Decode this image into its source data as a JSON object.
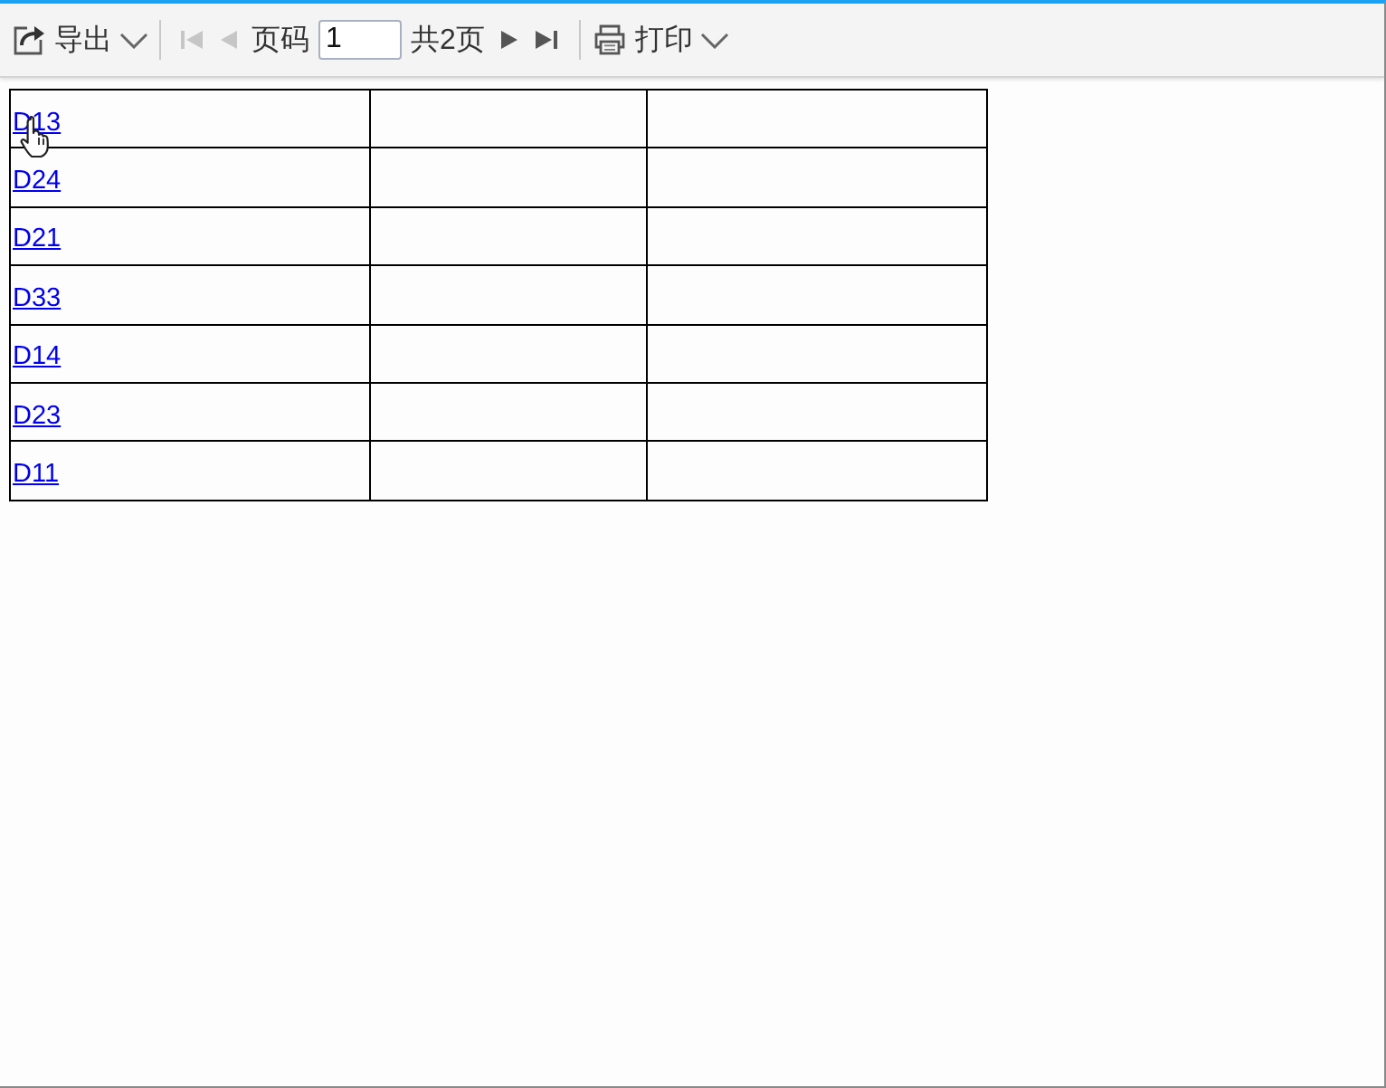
{
  "toolbar": {
    "export": {
      "label": "导出"
    },
    "nav_back": [
      {
        "kind": "first",
        "disabled": true
      },
      {
        "kind": "prev",
        "disabled": true
      }
    ],
    "page_label": "页码",
    "page_input": {
      "value": "1"
    },
    "total": "共2页",
    "nav_forward": [
      {
        "kind": "next",
        "disabled": false
      },
      {
        "kind": "last",
        "disabled": false
      }
    ],
    "print": {
      "label": "打印"
    }
  },
  "table": {
    "rows": [
      {
        "link": "D13"
      },
      {
        "link": "D24"
      },
      {
        "link": "D21"
      },
      {
        "link": "D33"
      },
      {
        "link": "D14"
      },
      {
        "link": "D23"
      },
      {
        "link": "D11"
      }
    ]
  }
}
